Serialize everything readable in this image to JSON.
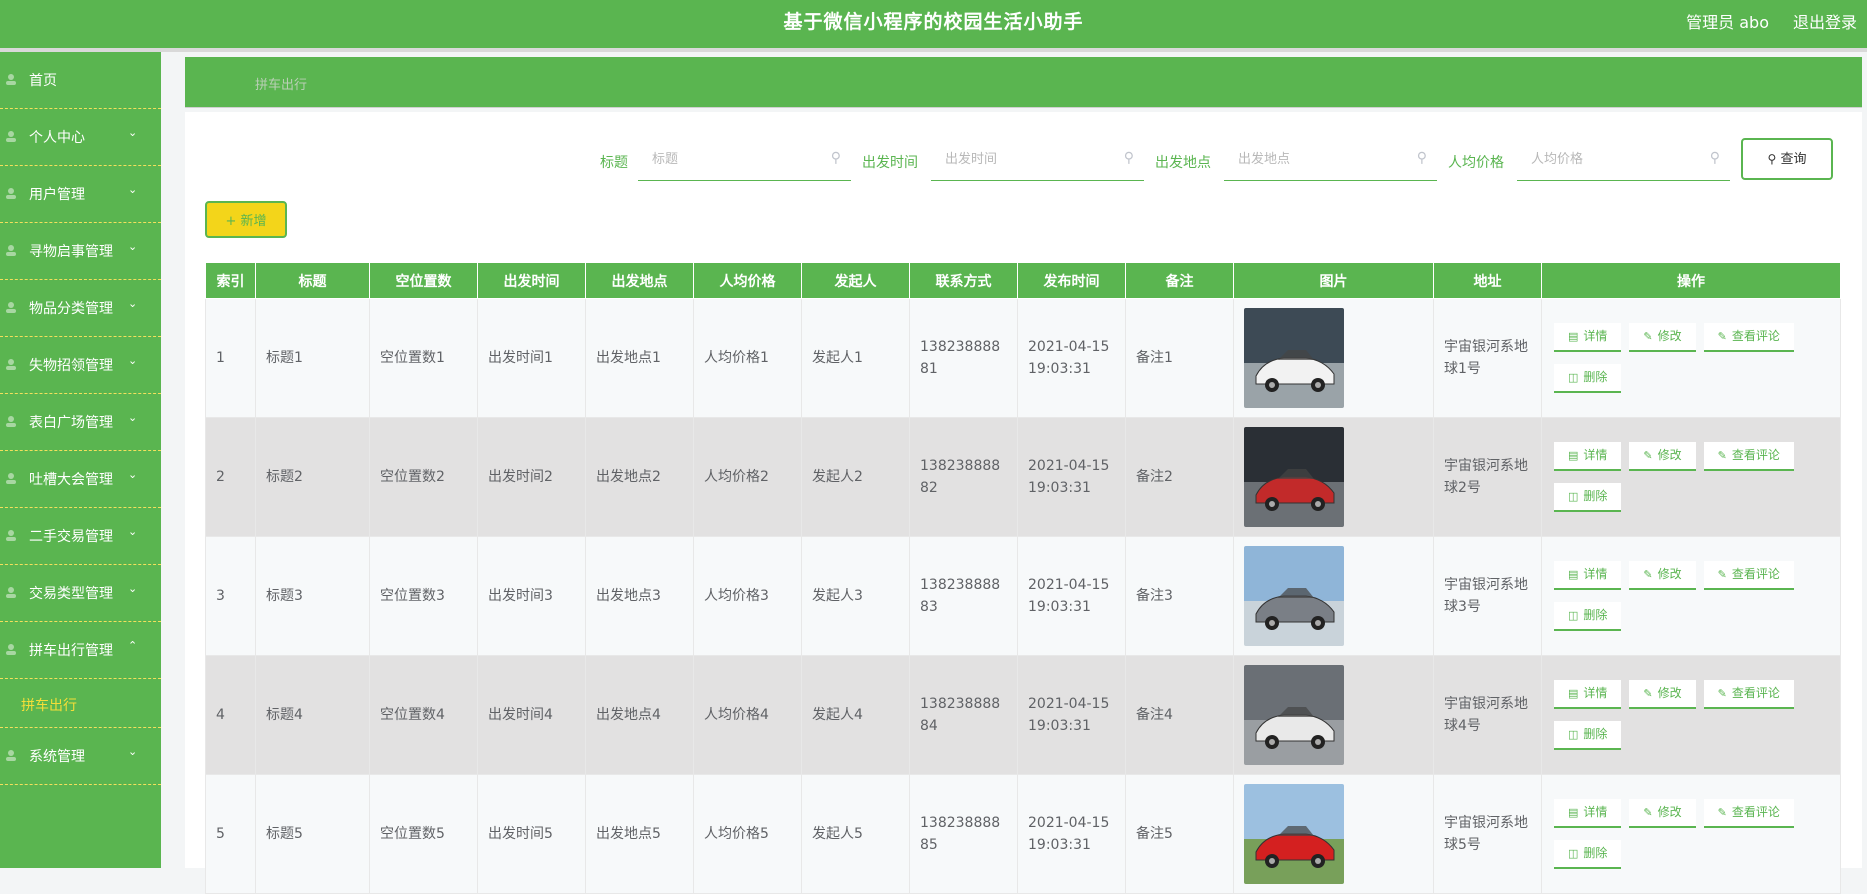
{
  "header": {
    "title": "基于微信小程序的校园生活小助手",
    "admin": "管理员 abo",
    "logout": "退出登录"
  },
  "sidebar": {
    "items": [
      {
        "label": "首页",
        "icon": "home-icon",
        "chevron": ""
      },
      {
        "label": "个人中心",
        "icon": "user-icon",
        "chevron": "⌄"
      },
      {
        "label": "用户管理",
        "icon": "users-icon",
        "chevron": "⌄"
      },
      {
        "label": "寻物启事管理",
        "icon": "search-doc-icon",
        "chevron": "⌄"
      },
      {
        "label": "物品分类管理",
        "icon": "category-icon",
        "chevron": "⌄"
      },
      {
        "label": "失物招领管理",
        "icon": "box-icon",
        "chevron": "⌄"
      },
      {
        "label": "表白广场管理",
        "icon": "heart-icon",
        "chevron": "⌄"
      },
      {
        "label": "吐槽大会管理",
        "icon": "chat-icon",
        "chevron": "⌄"
      },
      {
        "label": "二手交易管理",
        "icon": "trade-icon",
        "chevron": "⌄"
      },
      {
        "label": "交易类型管理",
        "icon": "tag-icon",
        "chevron": "⌄"
      },
      {
        "label": "拼车出行管理",
        "icon": "car-icon",
        "chevron": "⌃"
      }
    ],
    "submenu": "拼车出行",
    "last": {
      "label": "系统管理",
      "icon": "settings-icon",
      "chevron": "⌄"
    }
  },
  "breadcrumb": "拼车出行",
  "search": {
    "fields": [
      {
        "label": "标题",
        "placeholder": "标题"
      },
      {
        "label": "出发时间",
        "placeholder": "出发时间"
      },
      {
        "label": "出发地点",
        "placeholder": "出发地点"
      },
      {
        "label": "人均价格",
        "placeholder": "人均价格"
      }
    ],
    "query_label": "查询"
  },
  "add_label": "新增",
  "table": {
    "headers": [
      "索引",
      "标题",
      "空位置数",
      "出发时间",
      "出发地点",
      "人均价格",
      "发起人",
      "联系方式",
      "发布时间",
      "备注",
      "图片",
      "地址",
      "操作"
    ],
    "rows": [
      {
        "idx": "1",
        "title": "标题1",
        "seats": "空位置数1",
        "time": "出发时间1",
        "place": "出发地点1",
        "price": "人均价格1",
        "initiator": "发起人1",
        "phone": "13823888881",
        "published": "2021-04-15 19:03:31",
        "note": "备注1",
        "address": "宇宙银河系地球1号"
      },
      {
        "idx": "2",
        "title": "标题2",
        "seats": "空位置数2",
        "time": "出发时间2",
        "place": "出发地点2",
        "price": "人均价格2",
        "initiator": "发起人2",
        "phone": "13823888882",
        "published": "2021-04-15 19:03:31",
        "note": "备注2",
        "address": "宇宙银河系地球2号"
      },
      {
        "idx": "3",
        "title": "标题3",
        "seats": "空位置数3",
        "time": "出发时间3",
        "place": "出发地点3",
        "price": "人均价格3",
        "initiator": "发起人3",
        "phone": "13823888883",
        "published": "2021-04-15 19:03:31",
        "note": "备注3",
        "address": "宇宙银河系地球3号"
      },
      {
        "idx": "4",
        "title": "标题4",
        "seats": "空位置数4",
        "time": "出发时间4",
        "place": "出发地点4",
        "price": "人均价格4",
        "initiator": "发起人4",
        "phone": "13823888884",
        "published": "2021-04-15 19:03:31",
        "note": "备注4",
        "address": "宇宙银河系地球4号"
      },
      {
        "idx": "5",
        "title": "标题5",
        "seats": "空位置数5",
        "time": "出发时间5",
        "place": "出发地点5",
        "price": "人均价格5",
        "initiator": "发起人5",
        "phone": "13823888885",
        "published": "2021-04-15 19:03:31",
        "note": "备注5",
        "address": "宇宙银河系地球5号"
      }
    ],
    "ops": {
      "detail": "详情",
      "edit": "修改",
      "comments": "查看评论",
      "delete": "删除"
    }
  },
  "colors": {
    "primary": "#5ab550",
    "accent": "#f3d51a",
    "submenu_text": "#f4de38"
  }
}
